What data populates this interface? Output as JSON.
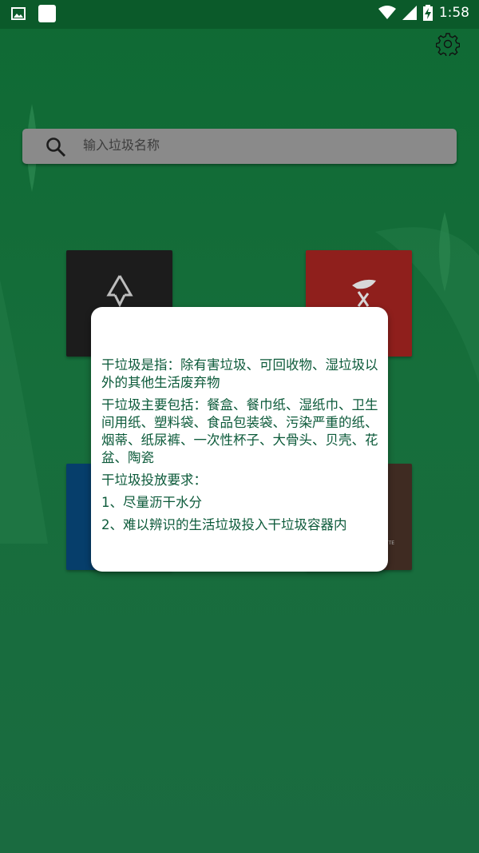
{
  "status_bar": {
    "time": "1:58",
    "icons": [
      "gallery-icon",
      "app-square-icon",
      "wifi-icon",
      "signal-icon",
      "battery-charging-icon"
    ]
  },
  "header": {
    "settings_icon": "gear-icon"
  },
  "search": {
    "placeholder": "输入垃圾名称",
    "value": "",
    "icon": "search-icon"
  },
  "categories": [
    {
      "id": "recyclable",
      "icon": "recycle-icon",
      "color": "#1c1c1c"
    },
    {
      "id": "hazardous",
      "icon": "hazardous-icon",
      "color": "#8f1f1c"
    },
    {
      "id": "wet",
      "icon": "wet-waste-icon",
      "color": "#063e6b"
    },
    {
      "id": "dry",
      "icon": "dry-waste-icon",
      "color": "#3f2b22",
      "label": "TE"
    }
  ],
  "dialog": {
    "definition": "干垃圾是指：除有害垃圾、可回收物、湿垃圾以外的其他生活废弃物",
    "includes": "干垃圾主要包括：餐盒、餐巾纸、湿纸巾、卫生间用纸、塑料袋、食品包装袋、污染严重的纸、烟蒂、纸尿裤、一次性杯子、大骨头、贝壳、花盆、陶瓷",
    "requirements_title": "干垃圾投放要求：",
    "requirement_1": "1、尽量沥干水分",
    "requirement_2": "2、难以辨识的生活垃圾投入干垃圾容器内"
  },
  "colors": {
    "background": "#166e3b",
    "status_bar": "#0b5a2a",
    "dialog_text": "#0c5a3a"
  }
}
